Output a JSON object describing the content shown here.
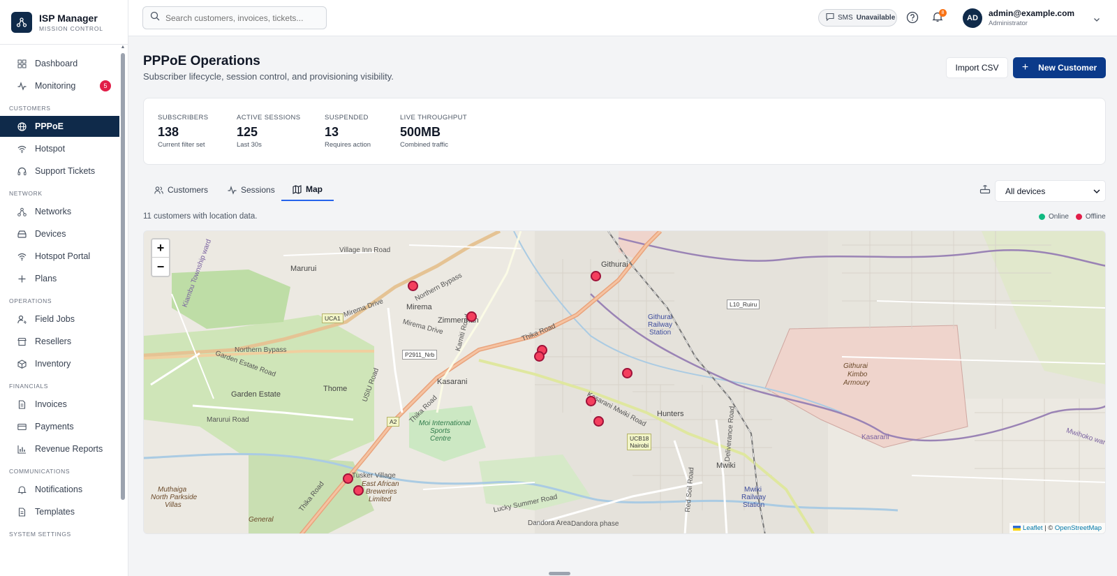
{
  "brand": {
    "title": "ISP Manager",
    "subtitle": "MISSION CONTROL"
  },
  "nav": {
    "top": [
      {
        "label": "Dashboard",
        "icon": "grid-icon"
      },
      {
        "label": "Monitoring",
        "icon": "activity-icon",
        "badge": "5"
      }
    ],
    "sections": [
      {
        "title": "CUSTOMERS",
        "items": [
          {
            "label": "PPPoE",
            "icon": "globe-icon",
            "active": true
          },
          {
            "label": "Hotspot",
            "icon": "wifi-icon"
          },
          {
            "label": "Support Tickets",
            "icon": "headset-icon"
          }
        ]
      },
      {
        "title": "NETWORK",
        "items": [
          {
            "label": "Networks",
            "icon": "network-icon"
          },
          {
            "label": "Devices",
            "icon": "router-icon"
          },
          {
            "label": "Hotspot Portal",
            "icon": "wifi-icon"
          },
          {
            "label": "Plans",
            "icon": "plus-icon"
          }
        ]
      },
      {
        "title": "OPERATIONS",
        "items": [
          {
            "label": "Field Jobs",
            "icon": "user-wrench-icon"
          },
          {
            "label": "Resellers",
            "icon": "store-icon"
          },
          {
            "label": "Inventory",
            "icon": "box-icon"
          }
        ]
      },
      {
        "title": "FINANCIALS",
        "items": [
          {
            "label": "Invoices",
            "icon": "file-icon"
          },
          {
            "label": "Payments",
            "icon": "card-icon"
          },
          {
            "label": "Revenue Reports",
            "icon": "bar-chart-icon"
          }
        ]
      },
      {
        "title": "COMMUNICATIONS",
        "items": [
          {
            "label": "Notifications",
            "icon": "bell-icon"
          },
          {
            "label": "Templates",
            "icon": "file-icon"
          }
        ]
      },
      {
        "title": "SYSTEM SETTINGS",
        "items": []
      }
    ]
  },
  "topbar": {
    "search_placeholder": "Search customers, invoices, tickets...",
    "sms_label": "SMS",
    "sms_status": "Unavailable",
    "notification_count": "8",
    "user_initials": "AD",
    "user_email": "admin@example.com",
    "user_role": "Administrator"
  },
  "page": {
    "title": "PPPoE Operations",
    "subtitle": "Subscriber lifecycle, session control, and provisioning visibility.",
    "import_label": "Import CSV",
    "new_label": "New Customer"
  },
  "stats": [
    {
      "label": "SUBSCRIBERS",
      "value": "138",
      "hint": "Current filter set"
    },
    {
      "label": "ACTIVE SESSIONS",
      "value": "125",
      "hint": "Last 30s"
    },
    {
      "label": "SUSPENDED",
      "value": "13",
      "hint": "Requires action"
    },
    {
      "label": "LIVE THROUGHPUT",
      "value": "500MB",
      "hint": "Combined traffic"
    }
  ],
  "tabs": [
    {
      "label": "Customers",
      "icon": "users-icon"
    },
    {
      "label": "Sessions",
      "icon": "activity-icon"
    },
    {
      "label": "Map",
      "icon": "map-icon",
      "active": true
    }
  ],
  "device_filter": {
    "value": "All devices"
  },
  "map": {
    "location_count_text": "11 customers with location data.",
    "legend": [
      {
        "label": "Online",
        "color": "#10b981"
      },
      {
        "label": "Offline",
        "color": "#e11d48"
      }
    ],
    "zoom_in": "+",
    "zoom_out": "−",
    "attribution_leaflet": "Leaflet",
    "attribution_sep": " | © ",
    "attribution_osm": "OpenStreetMap",
    "labels": {
      "marurui": "Marurui",
      "mirema": "Mirema",
      "zimmerman": "Zimmerman",
      "githurai": "Githurai",
      "kasarani": "Kasarani",
      "thome": "Thome",
      "garden_estate": "Garden Estate",
      "hunters": "Hunters",
      "mwiki": "Mwiki",
      "kimbo1": "Githurai",
      "kimbo2": "Kimbo",
      "kimbo3": "Armoury",
      "githurai_rail1": "Githurai",
      "githurai_rail2": "Railway",
      "githurai_rail3": "Station",
      "mwiki_rail1": "Mwiki",
      "mwiki_rail2": "Railway",
      "mwiki_rail3": "Station",
      "moi1": "Moi International",
      "moi2": "Sports",
      "moi3": "Centre",
      "tusker": "Tusker Village",
      "eab1": "East African",
      "eab2": "Breweries",
      "eab3": "Limited",
      "muthaiga1": "Muthaiga",
      "muthaiga2": "North Parkside",
      "muthaiga3": "Villas",
      "dandora_area": "Dandora Area",
      "dandora_phase": "Dandora phase",
      "village_inn": "Village Inn Road",
      "northern_bypass1": "Northern Bypass",
      "northern_bypass2": "Northern Bypass",
      "mirema_drive": "Mirema Drive",
      "mirema_drive2": "Mirema Drive",
      "thika_road": "Thika Road",
      "thika_road2": "Thika Road",
      "garden_estate_road": "Garden Estate Road",
      "usiu_road": "USIU Road",
      "marurui_road": "Marurui Road",
      "kamiti_road": "Kamiti Road",
      "kasarani_mwiki": "Kasarani Mwiki Road",
      "lucky_summer": "Lucky Summer Road",
      "red_soil": "Red Soil Road",
      "deliverance": "Deliverance Road",
      "kiambu_township": "Kiambu Township ward",
      "kasarani_ward": "Kasarani",
      "mwihoko_ward": "Mwihoko ward",
      "general": "General",
      "shield_uca1": "UCA1",
      "shield_p2911": "P2911_Nrb",
      "shield_l10": "L10_Ruiru",
      "shield_a2": "A2",
      "shield_ucb18_1": "UCB18",
      "shield_ucb18_2": "Nairobi"
    }
  }
}
